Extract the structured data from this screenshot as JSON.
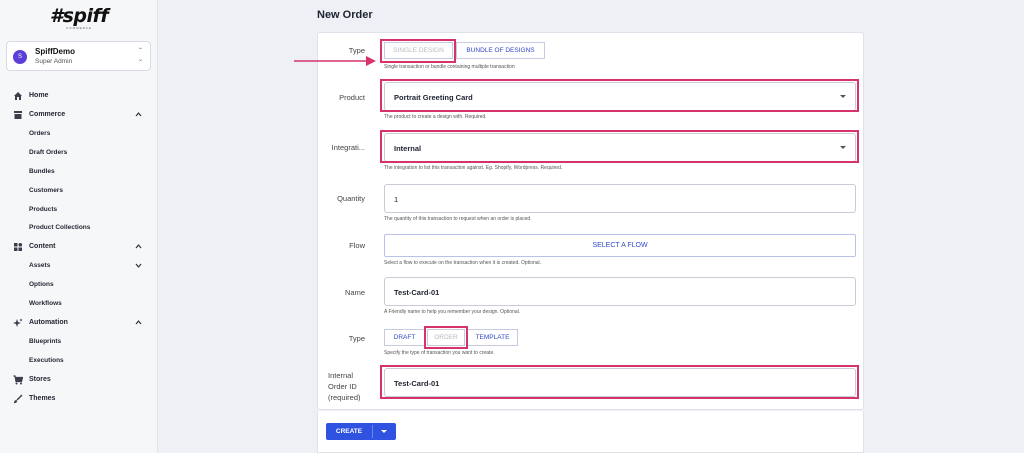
{
  "logo": {
    "text": "#spiff",
    "subtext": "COMMERCE"
  },
  "account": {
    "initial": "S",
    "name": "SpiffDemo",
    "role": "Super Admin"
  },
  "nav": {
    "home": "Home",
    "commerce": "Commerce",
    "orders": "Orders",
    "draft_orders": "Draft Orders",
    "bundles": "Bundles",
    "customers": "Customers",
    "products": "Products",
    "product_collections": "Product Collections",
    "content": "Content",
    "assets": "Assets",
    "options": "Options",
    "workflows": "Workflows",
    "automation": "Automation",
    "blueprints": "Blueprints",
    "executions": "Executions",
    "stores": "Stores",
    "themes": "Themes"
  },
  "page": {
    "title": "New Order"
  },
  "form": {
    "type1": {
      "label": "Type",
      "option_single": "SINGLE DESIGN",
      "option_bundle": "BUNDLE OF DESIGNS",
      "helper": "Single transaction or bundle containing multiple transaction"
    },
    "product": {
      "label": "Product",
      "value": "Portrait Greeting Card",
      "helper": "The product to create a design with. Required."
    },
    "integration": {
      "label": "Integrati...",
      "value": "Internal",
      "helper": "The integration to list this transaction against. Eg. Shopify, Wordpress. Required."
    },
    "quantity": {
      "label": "Quantity",
      "value": "1",
      "helper": "The quantity of this transaction to request when an order is placed."
    },
    "flow": {
      "label": "Flow",
      "button": "SELECT A FLOW",
      "helper": "Select a flow to execute on the transaction when it is created. Optional."
    },
    "name": {
      "label": "Name",
      "value": "Test-Card-01",
      "helper": "A Friendly name to help you remember your design. Optional."
    },
    "type2": {
      "label": "Type",
      "option_draft": "DRAFT",
      "option_order": "ORDER",
      "option_template": "TEMPLATE",
      "helper": "Specify the type of transaction you want to create."
    },
    "internal_order_id": {
      "label_line1": "Internal",
      "label_line2": "Order ID",
      "label_line3": "(required)",
      "value": "Test-Card-01"
    }
  },
  "actions": {
    "create": "CREATE"
  },
  "colors": {
    "accent": "#2f52e0",
    "highlight": "#d6336c",
    "avatar": "#5b3fd6"
  }
}
